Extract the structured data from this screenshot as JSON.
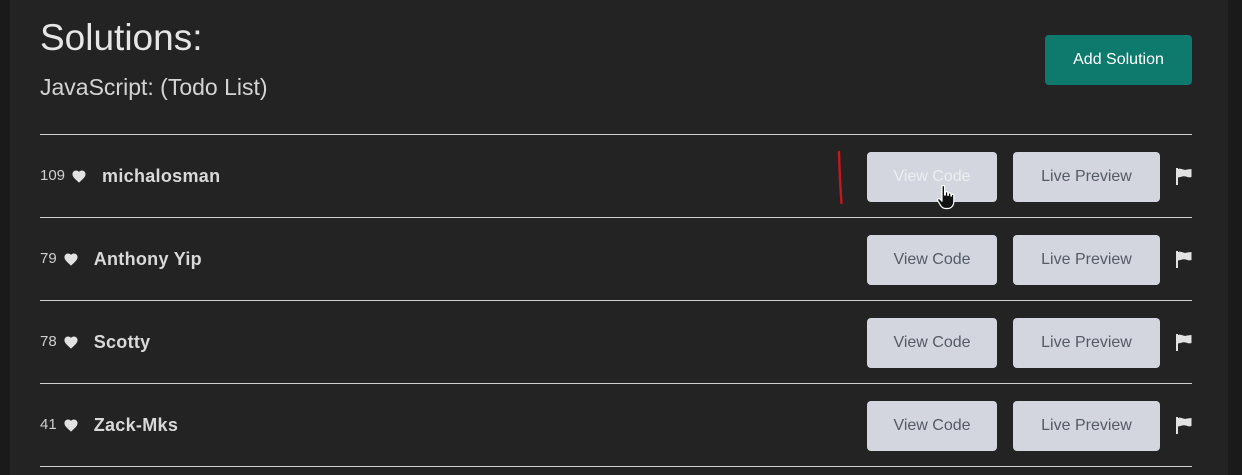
{
  "header": {
    "title": "Solutions:",
    "subtitle": "JavaScript: (Todo List)",
    "add_button_label": "Add Solution"
  },
  "colors": {
    "background": "#232323",
    "accent": "#0e7a6e",
    "button_bg": "#d3d6de",
    "button_text": "#545b66",
    "divider": "#cfcfcf",
    "annotation": "#c8161d"
  },
  "solutions": [
    {
      "likes": "109",
      "username": "michalosman",
      "view_label": "View Code",
      "preview_label": "Live Preview"
    },
    {
      "likes": "79",
      "username": "Anthony Yip",
      "view_label": "View Code",
      "preview_label": "Live Preview"
    },
    {
      "likes": "78",
      "username": "Scotty",
      "view_label": "View Code",
      "preview_label": "Live Preview"
    },
    {
      "likes": "41",
      "username": "Zack-Mks",
      "view_label": "View Code",
      "preview_label": "Live Preview"
    }
  ],
  "icons": {
    "like": "heart-icon",
    "report": "flag-icon",
    "pointer": "hand-pointer-cursor"
  }
}
